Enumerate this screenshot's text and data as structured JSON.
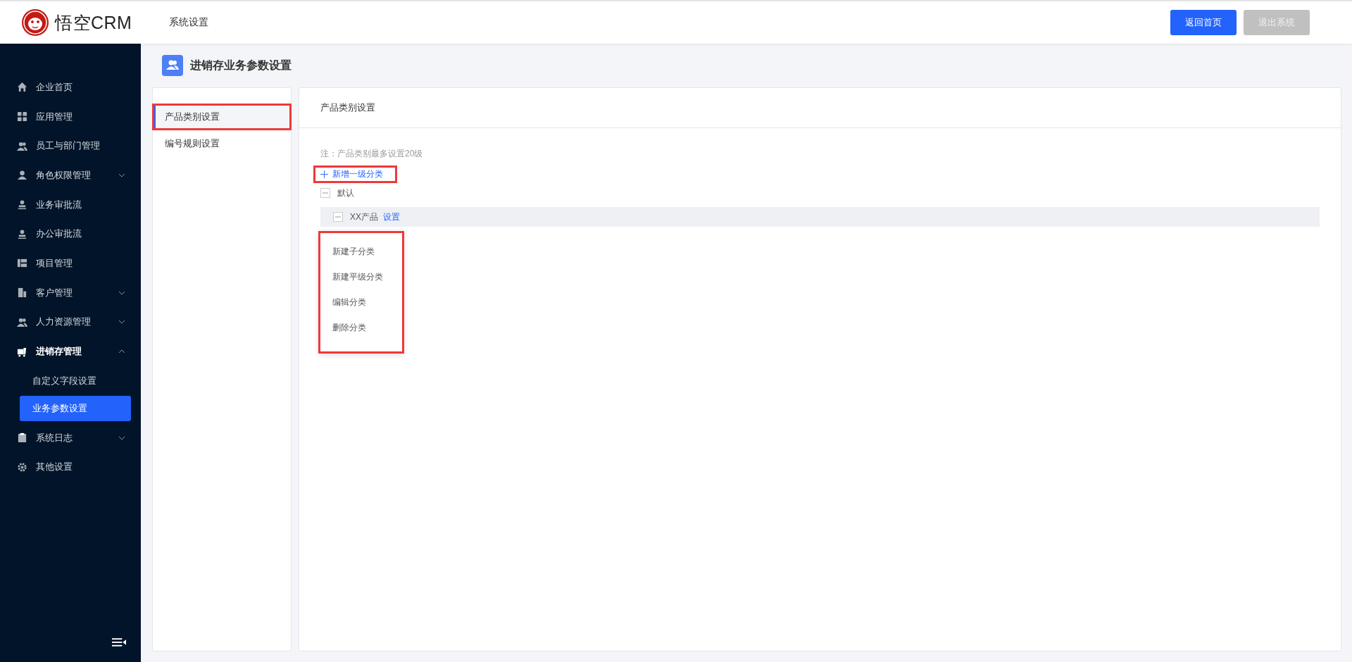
{
  "header": {
    "logo_text": "悟空CRM",
    "title": "系统设置",
    "buttons": [
      {
        "label": "返回首页",
        "disabled": false
      },
      {
        "label": "退出系统",
        "disabled": true
      }
    ]
  },
  "sidebar": {
    "items": [
      {
        "label": "企业首页",
        "selected": false
      },
      {
        "label": "应用管理",
        "selected": false
      },
      {
        "label": "员工与部门管理",
        "selected": false
      },
      {
        "label": "角色权限管理",
        "selected": false,
        "expanded": false
      },
      {
        "label": "业务审批流",
        "selected": false
      },
      {
        "label": "办公审批流",
        "selected": false
      },
      {
        "label": "项目管理",
        "selected": false
      },
      {
        "label": "客户管理",
        "selected": false,
        "expanded": false
      },
      {
        "label": "人力资源管理",
        "selected": false,
        "expanded": false
      },
      {
        "label": "进销存管理",
        "selected": false,
        "expanded": true,
        "children": [
          {
            "label": "自定义字段设置",
            "selected": false
          },
          {
            "label": "业务参数设置",
            "selected": true
          }
        ]
      },
      {
        "label": "系统日志",
        "selected": false,
        "expanded": false
      },
      {
        "label": "其他设置",
        "selected": false
      }
    ]
  },
  "page_title": "进销存业务参数设置",
  "tabs": [
    {
      "label": "产品类别设置",
      "selected": true,
      "highlighted": true
    },
    {
      "label": "编号规则设置",
      "selected": false,
      "highlighted": false
    }
  ],
  "panel": {
    "title": "产品类别设置",
    "note": "注：产品类别最多设置20级",
    "add_button": {
      "label": "新增一级分类",
      "highlighted": true
    },
    "tree": [
      {
        "label": "默认",
        "expanded": true,
        "children": [
          {
            "label": "XX产品",
            "expanded": true,
            "action": "设置",
            "hovered": true
          }
        ]
      }
    ],
    "menu": {
      "highlighted": true,
      "items": [
        "新建子分类",
        "新建平级分类",
        "编辑分类",
        "删除分类"
      ]
    }
  }
}
